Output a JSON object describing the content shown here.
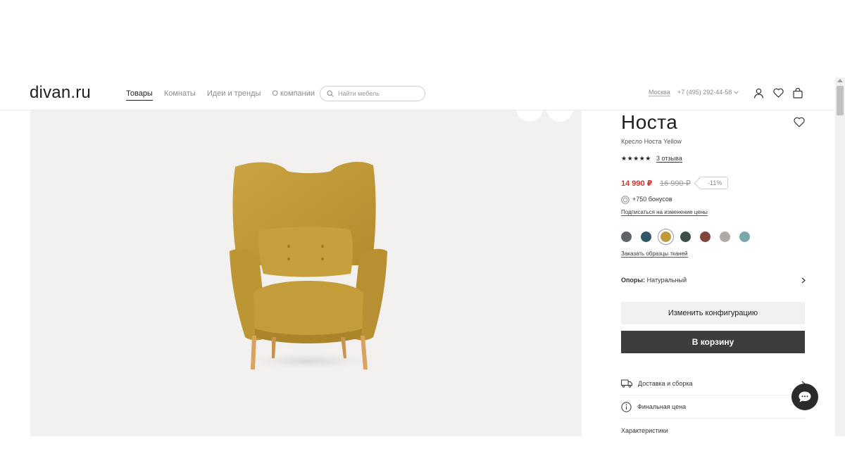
{
  "header": {
    "logo": "divan.ru",
    "nav": [
      {
        "label": "Товары",
        "active": true
      },
      {
        "label": "Комнаты",
        "active": false
      },
      {
        "label": "Идеи и тренды",
        "active": false
      },
      {
        "label": "О компании",
        "active": false
      }
    ],
    "search_placeholder": "Найти мебель",
    "city": "Москва",
    "phone": "+7 (495) 292-44-58"
  },
  "product": {
    "title": "Носта",
    "subtitle": "Кресло Носта Yellow",
    "rating_stars": "★★★★★",
    "reviews": "3 отзыва",
    "price": "14 990 ₽",
    "old_price": "16 990 ₽",
    "discount": "-11%",
    "bonus": "+750 бонусов",
    "subscribe_link": "Подписаться на изменение цены",
    "swatches": [
      {
        "color": "#606468",
        "selected": false
      },
      {
        "color": "#2f5768",
        "selected": false
      },
      {
        "color": "#c19a3e",
        "selected": true
      },
      {
        "color": "#3a4f48",
        "selected": false
      },
      {
        "color": "#83443d",
        "selected": false
      },
      {
        "color": "#b0aaa6",
        "selected": false
      },
      {
        "color": "#79a8ad",
        "selected": false
      }
    ],
    "samples_link": "Заказать образцы тканей",
    "supports_label": "Опоры:",
    "supports_value": "Натуральный",
    "config_button": "Изменить конфигурацию",
    "cart_button": "В корзину",
    "info_rows": [
      {
        "label": "Доставка и сборка",
        "icon": "truck-icon"
      },
      {
        "label": "Финальная цена",
        "icon": "info-icon"
      },
      {
        "label": "Характеристики",
        "icon": ""
      }
    ]
  },
  "colors": {
    "accent_price": "#c8362f",
    "cart_button_bg": "#3d3d3d",
    "gallery_bg": "#f2f1f0",
    "chair": "#c29c3a"
  }
}
